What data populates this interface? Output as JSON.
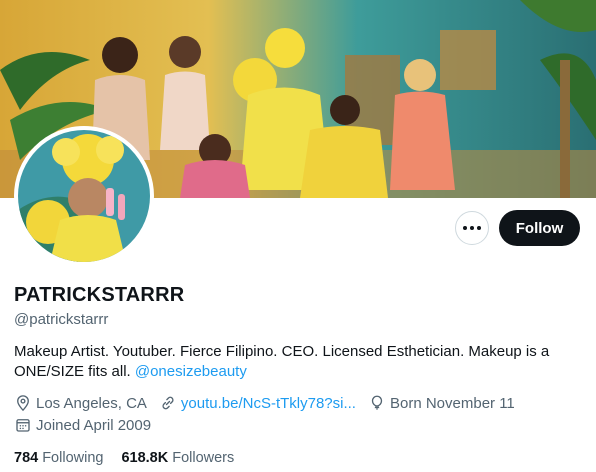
{
  "profile": {
    "display_name": "PATRICKSTARRR",
    "handle": "@patrickstarrr",
    "bio_text": "Makeup Artist. Youtuber. Fierce Filipino. CEO.  Licensed Esthetician. Makeup is a ONE/SIZE fits all. ",
    "bio_mention": "@onesizebeauty",
    "location": "Los Angeles, CA",
    "website": "youtu.be/NcS-tTkly78?si...",
    "birthday": "Born November 11",
    "joined": "Joined April 2009"
  },
  "actions": {
    "follow_label": "Follow",
    "more_icon": "more-dots-icon"
  },
  "stats": {
    "following_count": "784",
    "following_label": "Following",
    "followers_count": "618.8K",
    "followers_label": "Followers"
  },
  "colors": {
    "link": "#1d9bf0",
    "secondary_text": "#536471",
    "primary_text": "#0f1419",
    "follow_bg": "#0f1419"
  },
  "icons": {
    "location": "location-pin-icon",
    "website": "link-icon",
    "birthday": "balloon-icon",
    "joined": "calendar-icon"
  }
}
